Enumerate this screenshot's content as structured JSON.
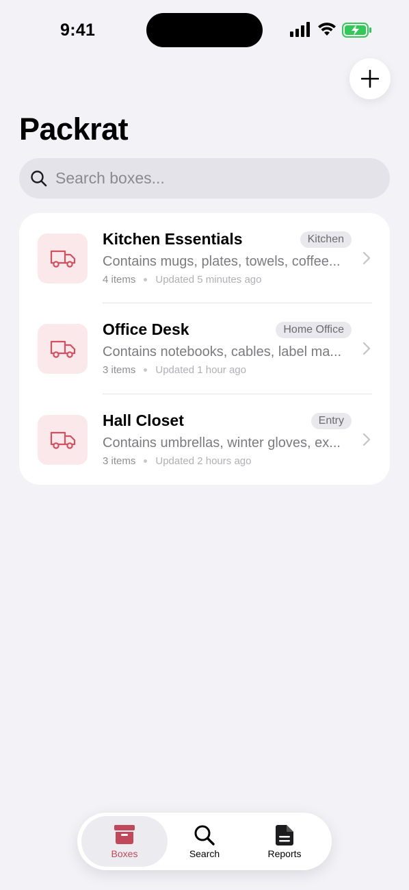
{
  "status": {
    "time": "9:41"
  },
  "header": {
    "title": "Packrat",
    "add_icon": "plus-icon"
  },
  "search": {
    "placeholder": "Search boxes..."
  },
  "colors": {
    "accent": "#c0485a",
    "thumb_bg": "#fbe8ea",
    "background": "#f2f2f7"
  },
  "boxes": [
    {
      "name": "Kitchen Essentials",
      "tag": "Kitchen",
      "description": "Contains mugs, plates, towels, coffee...",
      "count": "4 items",
      "updated": "Updated 5 minutes ago",
      "icon": "truck-icon"
    },
    {
      "name": "Office Desk",
      "tag": "Home Office",
      "description": "Contains notebooks, cables, label ma...",
      "count": "3 items",
      "updated": "Updated 1 hour ago",
      "icon": "truck-icon"
    },
    {
      "name": "Hall Closet",
      "tag": "Entry",
      "description": "Contains umbrellas, winter gloves, ex...",
      "count": "3 items",
      "updated": "Updated 2 hours ago",
      "icon": "truck-icon"
    }
  ],
  "tabs": [
    {
      "label": "Boxes",
      "icon": "archive-box-icon",
      "active": true
    },
    {
      "label": "Search",
      "icon": "search-icon",
      "active": false
    },
    {
      "label": "Reports",
      "icon": "document-icon",
      "active": false
    }
  ]
}
